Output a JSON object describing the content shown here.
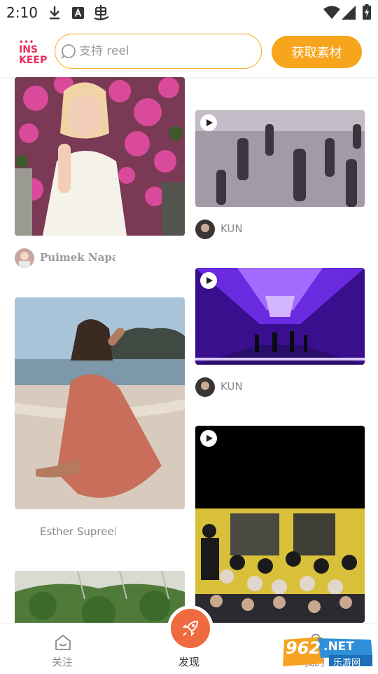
{
  "status": {
    "time": "2:10"
  },
  "header": {
    "logo_lines": [
      "INS",
      "KEEP"
    ],
    "search_placeholder": "支持 reel",
    "get_button_label": "获取素材"
  },
  "feed": {
    "left": [
      {
        "author": "Puimek Napasc",
        "type": "photo"
      },
      {
        "author": "Esther Supreelo",
        "type": "photo"
      },
      {
        "author": "",
        "type": "photo"
      }
    ],
    "right": [
      {
        "author": "KUN",
        "type": "video"
      },
      {
        "author": "KUN",
        "type": "video"
      },
      {
        "author": "",
        "type": "video"
      }
    ]
  },
  "bottom_nav": {
    "items": [
      {
        "label": "关注",
        "icon": "home-icon"
      },
      {
        "label": "发现",
        "icon": "rocket-icon"
      },
      {
        "label": "我的",
        "icon": "profile-icon"
      }
    ]
  },
  "watermark": {
    "number": "962",
    "suffix": ".NET",
    "site": "乐游网"
  },
  "colors": {
    "accent": "#f7a51c",
    "fab": "#f06a3f",
    "logo": "#ec2d5b"
  }
}
